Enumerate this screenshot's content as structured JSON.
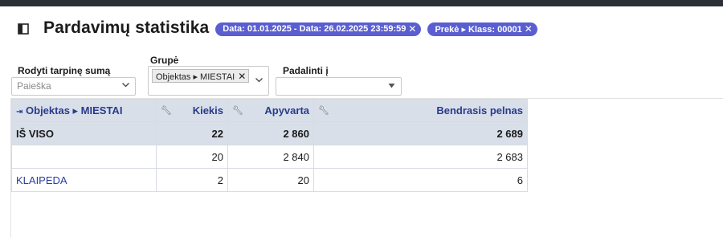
{
  "page": {
    "title": "Pardavimų statistika",
    "filters": [
      {
        "text": "Data: 01.01.2025 - Data: 26.02.2025 23:59:59"
      },
      {
        "text": "Prekė ▸ Klass: 00001"
      }
    ],
    "close_glyph": "✕"
  },
  "controls": {
    "subtotal_label": "Rodyti tarpinę sumą",
    "subtotal_placeholder": "Paieška",
    "group_label": "Grupė",
    "group_token": "Objektas ▸ MIESTAI",
    "split_label": "Padalinti į",
    "split_value": ""
  },
  "table": {
    "columns": [
      {
        "label": "Objektas ▸ MIESTAI",
        "icon": "collapse-icon"
      },
      {
        "label": "Kiekis",
        "icon": "wrench-icon"
      },
      {
        "label": "Apyvarta",
        "icon": "wrench-icon"
      },
      {
        "label": "Bendrasis pelnas",
        "icon": "wrench-icon"
      }
    ],
    "total": {
      "label": "IŠ VISO",
      "kiekis": "22",
      "apyvarta": "2 860",
      "pelnas": "2 689"
    },
    "rows": [
      {
        "label": "",
        "kiekis": "20",
        "apyvarta": "2 840",
        "pelnas": "2 683"
      },
      {
        "label": "KLAIPEDA",
        "kiekis": "2",
        "apyvarta": "20",
        "pelnas": "6"
      }
    ]
  },
  "colors": {
    "accent": "#5a5ed1",
    "header_bg": "#d8dfe9",
    "header_text": "#2a3a8c",
    "link": "#2d3da1"
  }
}
